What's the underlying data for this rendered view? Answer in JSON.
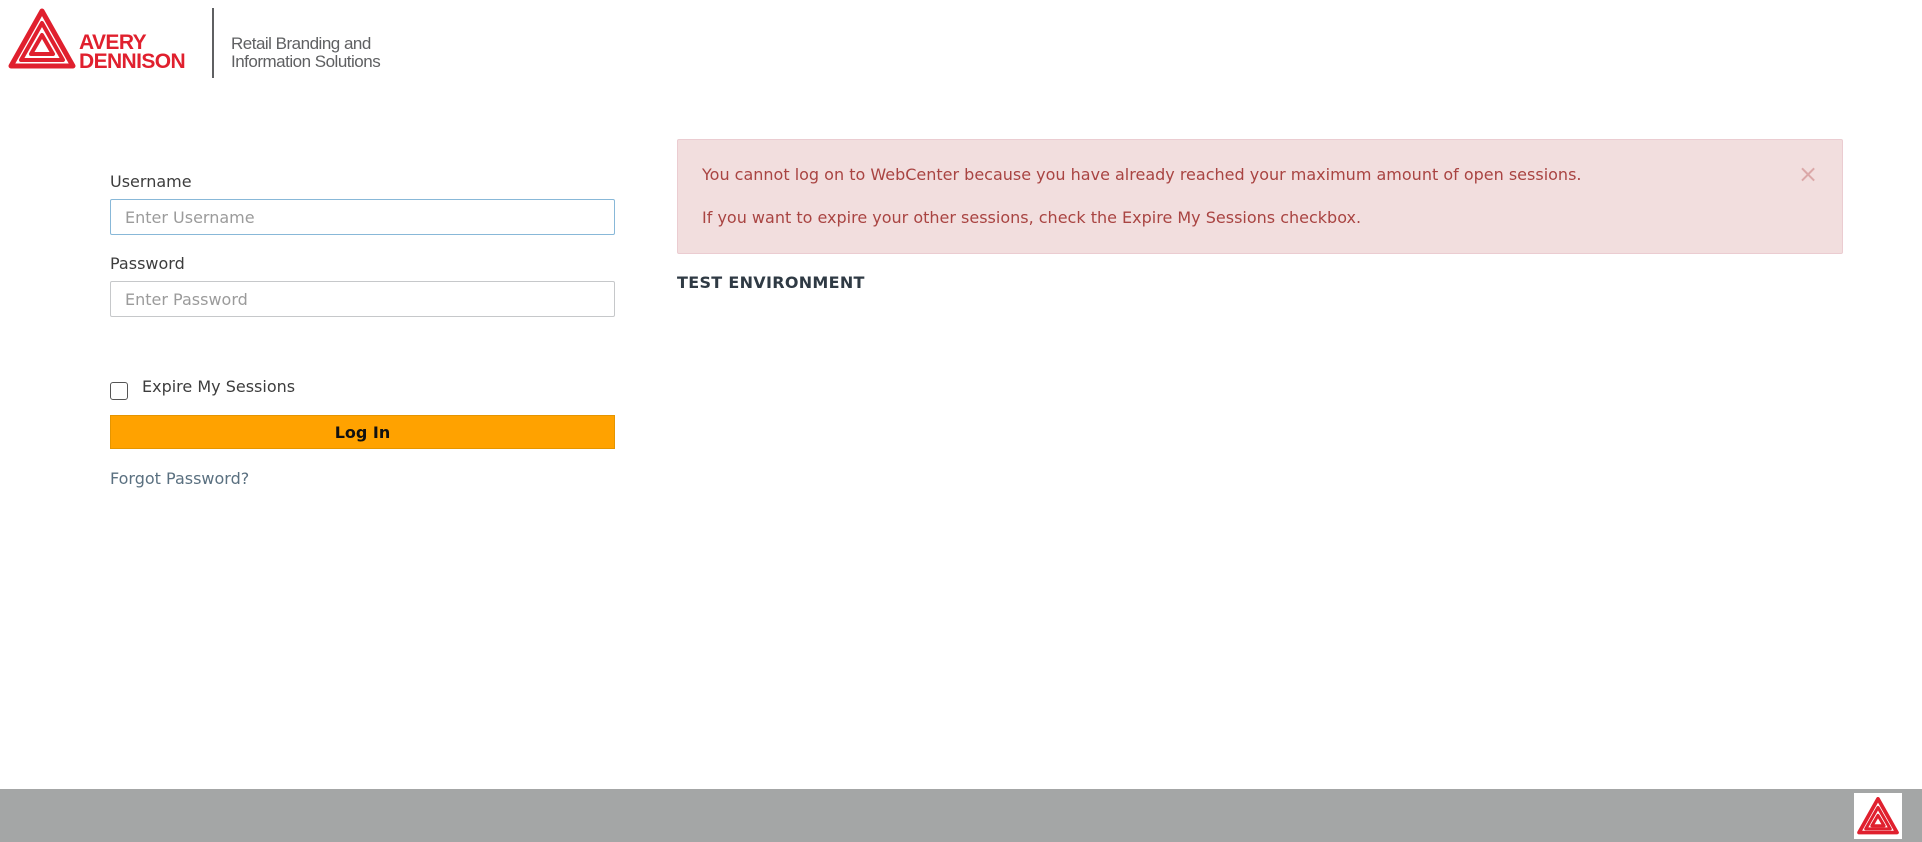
{
  "brand": {
    "name_line1": "AVERY",
    "name_line2": "DENNISON",
    "tagline_line1": "Retail Branding and",
    "tagline_line2": "Information Solutions",
    "logo_icon": "avery-dennison-triangle-icon",
    "color": "#e0202e"
  },
  "login": {
    "username_label": "Username",
    "username_placeholder": "Enter Username",
    "username_value": "",
    "password_label": "Password",
    "password_placeholder": "Enter Password",
    "password_value": "",
    "expire_sessions_label": "Expire My Sessions",
    "expire_sessions_checked": false,
    "login_button_label": "Log In",
    "login_button_color": "#ffa200",
    "forgot_password_label": "Forgot Password?"
  },
  "alert": {
    "line1": "You cannot log on to WebCenter because you have already reached your maximum amount of open sessions.",
    "line2": "If you want to expire your other sessions, check the Expire My Sessions checkbox.",
    "close_glyph": "×",
    "close_icon": "close-icon",
    "text_color": "#a94442",
    "background": "#f2dede"
  },
  "environment_label": "TEST ENVIRONMENT",
  "footer": {
    "background": "#a4a6a6",
    "badge_icon": "avery-dennison-triangle-icon"
  }
}
